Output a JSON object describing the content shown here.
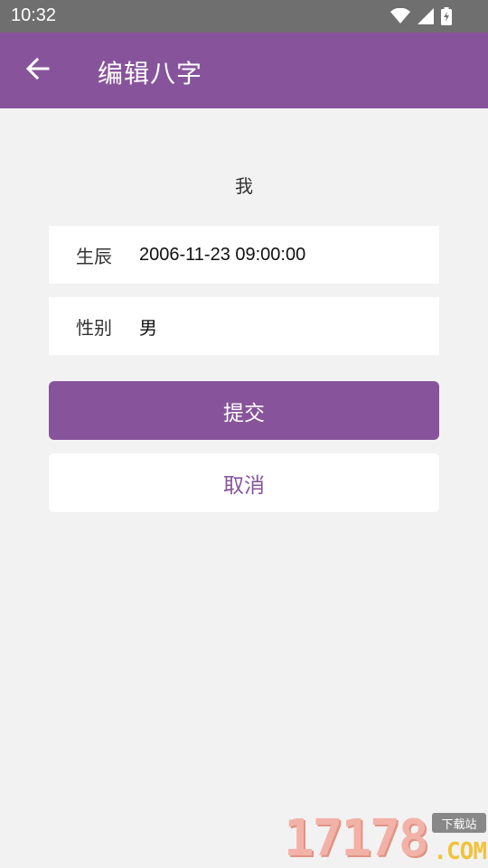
{
  "status_bar": {
    "time": "10:32",
    "icons": [
      "wifi-icon",
      "signal-icon",
      "battery-charging-icon"
    ]
  },
  "app_bar": {
    "back_icon": "arrow-left-icon",
    "title": "编辑八字",
    "color": "#87549b"
  },
  "profile": {
    "owner": "我"
  },
  "form": {
    "birth_label": "生辰",
    "birth_value": "2006-11-23 09:00:00",
    "gender_label": "性别",
    "gender_value": "男"
  },
  "actions": {
    "submit_label": "提交",
    "cancel_label": "取消"
  },
  "watermark": {
    "digits": "17178",
    "tag": "下载站",
    "suffix": ".COM"
  }
}
